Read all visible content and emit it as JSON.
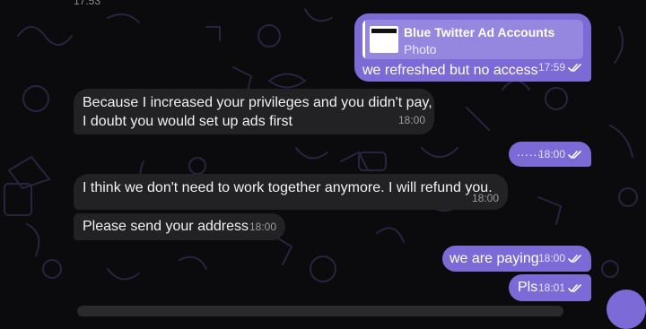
{
  "colors": {
    "background": "#0b0b0e",
    "incoming_bubble": "#222224",
    "outgoing_bubble": "#7c6bd6",
    "doodle": "#2a2340"
  },
  "top_clip": {
    "time": "17:53"
  },
  "messages": [
    {
      "id": "m1",
      "direction": "outgoing",
      "reply_title": "Blue Twitter Ad Accounts",
      "reply_subtitle": "Photo",
      "text": "we refreshed but no access",
      "time": "17:59",
      "status_icon": "double-check-icon"
    },
    {
      "id": "m2",
      "direction": "incoming",
      "text_line1": "Because I increased your privileges and you didn't pay,",
      "text_line2": "I doubt you would set up ads first",
      "time": "18:00"
    },
    {
      "id": "m3",
      "direction": "outgoing",
      "text": "......",
      "time": "18:00",
      "status_icon": "double-check-icon"
    },
    {
      "id": "m4",
      "direction": "incoming",
      "text": "I think we don't need to work together anymore. I will refund you.",
      "time": "18:00"
    },
    {
      "id": "m5",
      "direction": "incoming",
      "text": "Please send your address",
      "time": "18:00"
    },
    {
      "id": "m6",
      "direction": "outgoing",
      "text": "we are paying",
      "time": "18:00",
      "status_icon": "double-check-icon"
    },
    {
      "id": "m7",
      "direction": "outgoing",
      "text": "Pls",
      "time": "18:01",
      "status_icon": "double-check-icon"
    }
  ]
}
